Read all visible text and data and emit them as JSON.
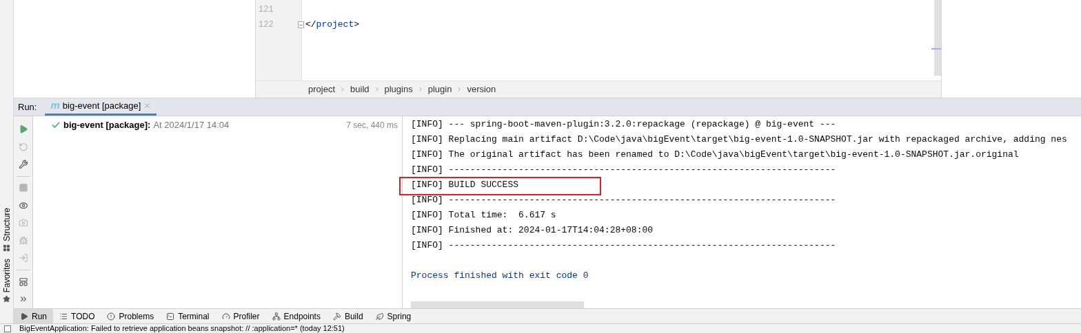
{
  "editor": {
    "lines": [
      {
        "number": "121"
      },
      {
        "number": "122",
        "fold": true,
        "tokens": [
          {
            "text": "</",
            "kind": "punct"
          },
          {
            "text": "project",
            "kind": "tag"
          },
          {
            "text": ">",
            "kind": "punct"
          }
        ]
      }
    ],
    "breadcrumbs": [
      "project",
      "build",
      "plugins",
      "plugin",
      "version"
    ]
  },
  "side_stripe": [
    {
      "label": "Structure",
      "kind": "structure"
    },
    {
      "label": "Favorites",
      "kind": "favorites"
    }
  ],
  "run_panel": {
    "label": "Run:",
    "tab": {
      "icon": "m",
      "label": "big-event [package]",
      "selected": true
    },
    "toolbar": [
      {
        "kind": "run",
        "disabled": false
      },
      {
        "kind": "rerun",
        "disabled": true
      },
      {
        "kind": "settings",
        "disabled": false
      },
      {
        "kind": "divider"
      },
      {
        "kind": "stop",
        "disabled": true
      },
      {
        "kind": "eye",
        "disabled": false
      },
      {
        "kind": "camera",
        "disabled": true
      },
      {
        "kind": "debug",
        "disabled": true
      },
      {
        "kind": "import",
        "disabled": true
      },
      {
        "kind": "divider"
      },
      {
        "kind": "layout",
        "disabled": false
      },
      {
        "kind": "more",
        "disabled": false
      }
    ],
    "tree": [
      {
        "name": "big-event [package]:",
        "detail": "At 2024/1/17 14:04",
        "duration": "7 sec, 440 ms",
        "passed": true
      }
    ],
    "console": [
      {
        "text": "[INFO] --- spring-boot-maven-plugin:3.2.0:repackage (repackage) @ big-event ---",
        "highlighted": false
      },
      {
        "text": "[INFO] Replacing main artifact D:\\Code\\java\\bigEvent\\target\\big-event-1.0-SNAPSHOT.jar with repackaged archive, adding nes",
        "highlighted": false
      },
      {
        "text": "[INFO] The original artifact has been renamed to D:\\Code\\java\\bigEvent\\target\\big-event-1.0-SNAPSHOT.jar.original",
        "highlighted": false
      },
      {
        "text": "[INFO] ------------------------------------------------------------------------",
        "highlighted": false
      },
      {
        "text": "[INFO] BUILD SUCCESS",
        "highlighted": true
      },
      {
        "text": "[INFO] ------------------------------------------------------------------------",
        "highlighted": false
      },
      {
        "text": "[INFO] Total time:  6.617 s",
        "highlighted": false
      },
      {
        "text": "[INFO] Finished at: 2024-01-17T14:04:28+08:00",
        "highlighted": false
      },
      {
        "text": "[INFO] ------------------------------------------------------------------------",
        "highlighted": false
      }
    ],
    "exit_message": "Process finished with exit code 0"
  },
  "tool_windows": [
    {
      "label": "Run",
      "kind": "run",
      "selected": true
    },
    {
      "label": "TODO",
      "kind": "todo",
      "selected": false
    },
    {
      "label": "Problems",
      "kind": "problems",
      "selected": false
    },
    {
      "label": "Terminal",
      "kind": "terminal",
      "selected": false
    },
    {
      "label": "Profiler",
      "kind": "profiler",
      "selected": false
    },
    {
      "label": "Endpoints",
      "kind": "endpoints",
      "selected": false
    },
    {
      "label": "Build",
      "kind": "build",
      "selected": false
    },
    {
      "label": "Spring",
      "kind": "spring",
      "selected": false
    }
  ],
  "status_bar": {
    "message": "BigEventApplication: Failed to retrieve application beans snapshot: // :application=* (today 12:51)"
  }
}
